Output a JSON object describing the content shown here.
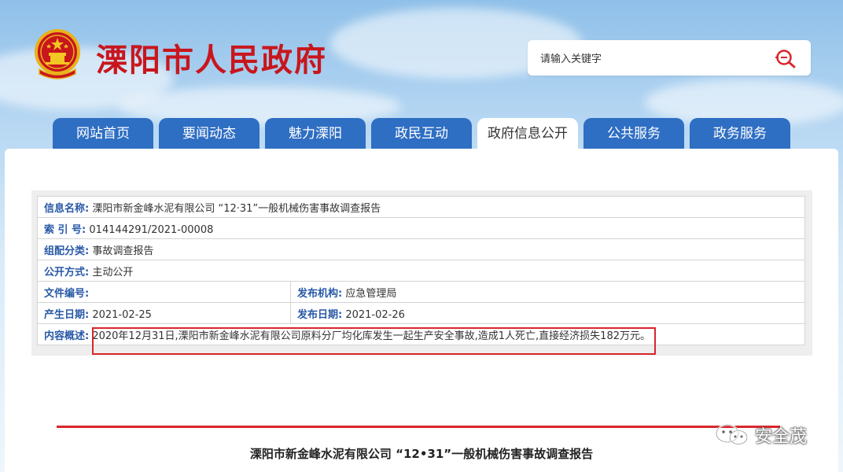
{
  "header": {
    "site_title": "溧阳市人民政府",
    "search_placeholder": "请输入关键字"
  },
  "nav": {
    "tabs": [
      {
        "label": "网站首页",
        "active": false
      },
      {
        "label": "要闻动态",
        "active": false
      },
      {
        "label": "魅力溧阳",
        "active": false
      },
      {
        "label": "政民互动",
        "active": false
      },
      {
        "label": "政府信息公开",
        "active": true
      },
      {
        "label": "公共服务",
        "active": false
      },
      {
        "label": "政务服务",
        "active": false
      }
    ]
  },
  "info": {
    "name_label": "信息名称:",
    "name_value": "溧阳市新金峰水泥有限公司 “12·31”一般机械伤害事故调查报告",
    "index_label": "索 引 号:",
    "index_value": "014144291/2021-00008",
    "category_label": "组配分类:",
    "category_value": "事故调查报告",
    "mode_label": "公开方式:",
    "mode_value": "主动公开",
    "doc_no_label": "文件编号:",
    "doc_no_value": "",
    "org_label": "发布机构:",
    "org_value": "应急管理局",
    "created_label": "产生日期:",
    "created_value": "2021-02-25",
    "published_label": "发布日期:",
    "published_value": "2021-02-26",
    "summary_label": "内容概述:",
    "summary_value": "2020年12月31日,溧阳市新金峰水泥有限公司原料分厂均化库发生一起生产安全事故,造成1人死亡,直接经济损失182万元。"
  },
  "article": {
    "title": "溧阳市新金峰水泥有限公司 “12•31”一般机械伤害事故调查报告"
  },
  "watermark": {
    "text": "安全茂"
  },
  "colors": {
    "brand_red": "#c8161d",
    "nav_blue": "#2e6ec3",
    "label_blue": "#2859a6",
    "highlight_red": "#d9262c"
  }
}
